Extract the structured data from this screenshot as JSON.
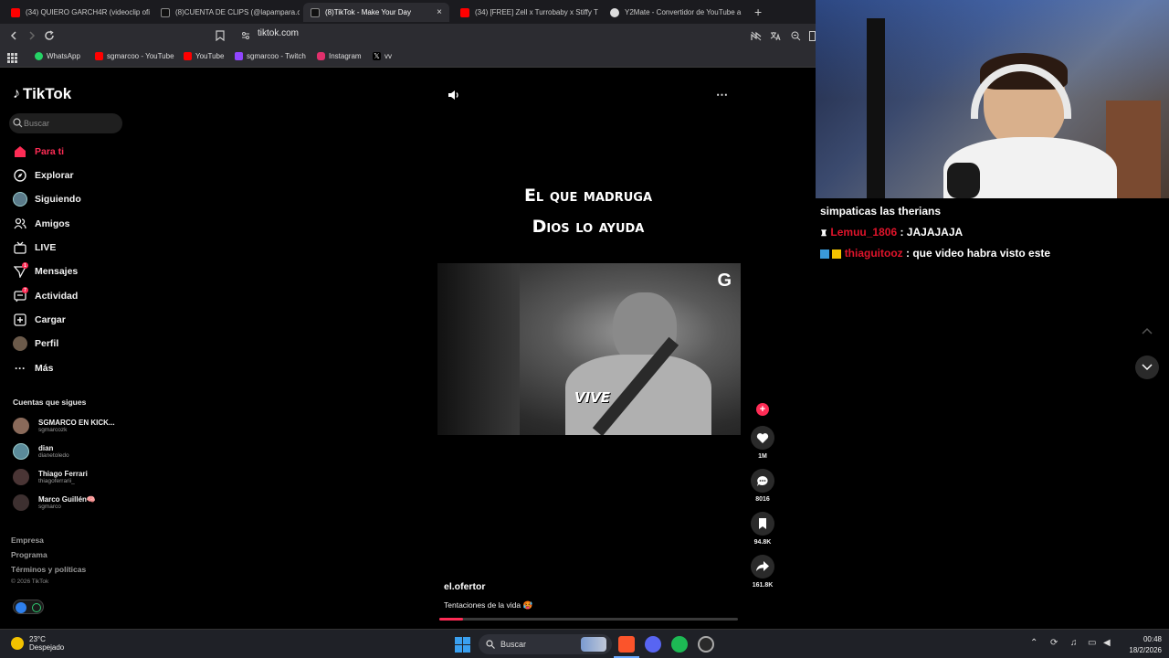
{
  "browser": {
    "tabs": [
      {
        "title": "(34) QUIERO GARCH4R (videoclip ofi",
        "icon": "youtube-icon"
      },
      {
        "title": "(8)CUENTA DE CLIPS (@lapampara.cl",
        "icon": "tiktok-icon"
      },
      {
        "title": "(8)TikTok - Make Your Day",
        "icon": "tiktok-icon",
        "active": true
      },
      {
        "title": "(34) [FREE] Zell x Turrobaby x Stiffy T",
        "icon": "youtube-icon"
      },
      {
        "title": "Y2Mate - Convertidor de YouTube a",
        "icon": "y2mate-icon"
      }
    ],
    "close_glyph": "×",
    "new_tab_glyph": "+",
    "url": "tiktok.com",
    "bookmarks": [
      {
        "label": "WhatsApp",
        "color": "#25d366"
      },
      {
        "label": "sgmarcoo - YouTube",
        "color": "#ff0000"
      },
      {
        "label": "YouTube",
        "color": "#ff0000"
      },
      {
        "label": "sgmarcoo - Twitch",
        "color": "#9146ff"
      },
      {
        "label": "Instagram",
        "color": "#e1306c"
      },
      {
        "label": "vv",
        "color": "#ffffff"
      }
    ]
  },
  "tiktok": {
    "logo": "TikTok",
    "search_placeholder": "Buscar",
    "nav": [
      {
        "label": "Para ti",
        "icon": "home-icon",
        "active": true
      },
      {
        "label": "Explorar",
        "icon": "compass-icon"
      },
      {
        "label": "Siguiendo",
        "icon": "following-avatar-icon"
      },
      {
        "label": "Amigos",
        "icon": "friends-icon"
      },
      {
        "label": "LIVE",
        "icon": "live-icon"
      },
      {
        "label": "Mensajes",
        "icon": "messages-icon",
        "badge": "1"
      },
      {
        "label": "Actividad",
        "icon": "activity-icon",
        "badge": "7"
      },
      {
        "label": "Cargar",
        "icon": "upload-icon"
      },
      {
        "label": "Perfil",
        "icon": "profile-avatar-icon"
      },
      {
        "label": "Más",
        "icon": "more-icon"
      }
    ],
    "following_title": "Cuentas que sigues",
    "following": [
      {
        "name": "SGMARCO EN KICK...",
        "handle": "sgmarcozk"
      },
      {
        "name": "dian",
        "handle": "dianetoledo"
      },
      {
        "name": "Thiago Ferrari",
        "handle": "thiagoferrarii_"
      },
      {
        "name": "Marco Guillén🧠",
        "handle": "sgmarco"
      }
    ],
    "footer": [
      "Empresa",
      "Programa",
      "Términos y políticas"
    ],
    "copyright": "© 2026 TikTok",
    "video": {
      "caption_line1": "El que madruga",
      "caption_line2": "Dios lo ayuda",
      "overlay_text": "VIVE",
      "watermark": "G",
      "author": "el.ofertor",
      "description": "Tentaciones de la vida 🥵",
      "progress": 0.08,
      "more_glyph": "⋯",
      "actions": [
        {
          "name": "follow",
          "count": "",
          "icon": "plus-icon"
        },
        {
          "name": "like",
          "count": "1M",
          "icon": "heart-icon"
        },
        {
          "name": "comment",
          "count": "8016",
          "icon": "comment-icon"
        },
        {
          "name": "save",
          "count": "94.8K",
          "icon": "bookmark-icon"
        },
        {
          "name": "share",
          "count": "161.8K",
          "icon": "share-icon"
        }
      ]
    }
  },
  "chat": {
    "messages": [
      {
        "user": "",
        "text": "simpaticas las therians"
      },
      {
        "user": "Lemuu_1806",
        "text": ": JAJAJAJA"
      },
      {
        "user": "thiaguitooz",
        "text": ": que video habra visto este"
      }
    ]
  },
  "taskbar": {
    "weather_temp": "23°C",
    "weather_desc": "Despejado",
    "search_placeholder": "Buscar",
    "time": "00:48",
    "date": "18/2/2026"
  }
}
